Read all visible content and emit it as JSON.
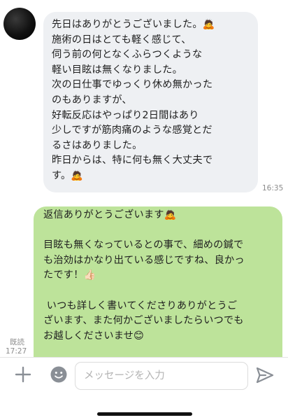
{
  "received": {
    "text": "先日はありがとうございました。🙇\n施術の日はとても軽く感じて、\n伺う前の何となくふらつくような\n軽い目眩は無くなりました。\n次の日仕事でゆっくり休め無かった\nのもありますが、\n好転反応はやっぱり2日間はあり\n少しですが筋肉痛のような感覚とだ\nるさはありました。\n昨日からは、特に何も無く大丈夫で\nす。🙇",
    "time": "16:35"
  },
  "sent": {
    "text": "返信ありがとうございます🙇\n\n目眩も無くなっているとの事で、細めの鍼で\nも治効はかなり出ている感じですね、良かっ\nたです！👍🏻\n\n いつも詳しく書いてくださりありがとうご\nざいます、また何かございましたらいつでも\nお越しくださいませ😊",
    "read_label": "既読",
    "time": "17:27"
  },
  "input": {
    "placeholder": "メッセージを入力",
    "value": ""
  },
  "icons": {
    "plus": "plus-icon",
    "emoji": "emoji-icon",
    "send": "send-icon"
  },
  "colors": {
    "received_bubble": "#eef0f3",
    "sent_bubble": "#bde39a",
    "icon": "#8a8f96"
  }
}
